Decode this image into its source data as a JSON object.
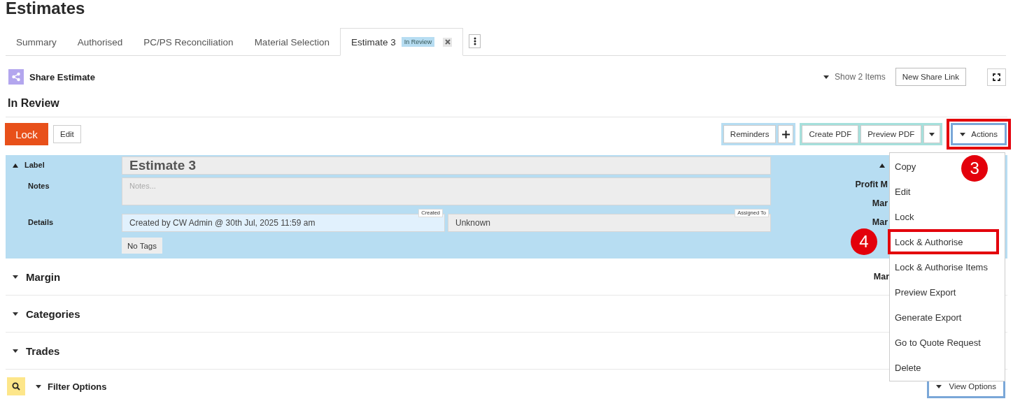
{
  "page": {
    "title": "Estimates"
  },
  "tabs": [
    {
      "label": "Summary",
      "selected": false
    },
    {
      "label": "Authorised",
      "selected": false
    },
    {
      "label": "PC/PS Reconciliation",
      "selected": false
    },
    {
      "label": "Material Selection",
      "selected": false
    },
    {
      "label": "Estimate 3",
      "selected": true,
      "badge": "In Review",
      "closable": true
    }
  ],
  "share": {
    "title": "Share Estimate",
    "show_items": "Show 2 Items",
    "new_link": "New Share Link"
  },
  "status_heading": "In Review",
  "toolbar": {
    "lock": "Lock",
    "edit": "Edit",
    "reminders": "Reminders",
    "create_pdf": "Create PDF",
    "preview_pdf": "Preview PDF",
    "actions": "Actions",
    "actions_marked": true,
    "actions_callout": "3"
  },
  "details_panel": {
    "expanded": true,
    "label_caption": "Label",
    "label_value": "Estimate 3",
    "notes_caption": "Notes",
    "notes_placeholder": "Notes...",
    "details_caption": "Details",
    "created_tag": "Created",
    "created_value": "Created by  CW Admin @ 30th Jul, 2025 11:59 am",
    "assigned_tag": "Assigned To",
    "assigned_value": "Unknown",
    "tags": "No Tags",
    "right_labels": [
      "Profit M",
      "Mar",
      "Mar"
    ]
  },
  "sections": [
    {
      "title": "Margin",
      "expanded": false,
      "right_label": "Mar"
    },
    {
      "title": "Categories",
      "expanded": false
    },
    {
      "title": "Trades",
      "expanded": false
    }
  ],
  "filter": {
    "label": "Filter Options",
    "view_options": "View Options"
  },
  "actions_menu": {
    "items": [
      {
        "label": "Copy",
        "marked": false
      },
      {
        "label": "Edit",
        "marked": false
      },
      {
        "label": "Lock",
        "marked": false
      },
      {
        "label": "Lock & Authorise",
        "marked": true,
        "callout": "4"
      },
      {
        "label": "Lock & Authorise Items",
        "marked": false
      },
      {
        "label": "Preview Export",
        "marked": false
      },
      {
        "label": "Generate Export",
        "marked": false
      },
      {
        "label": "Go to Quote Request",
        "marked": false
      },
      {
        "label": "Delete",
        "marked": false
      }
    ]
  }
}
